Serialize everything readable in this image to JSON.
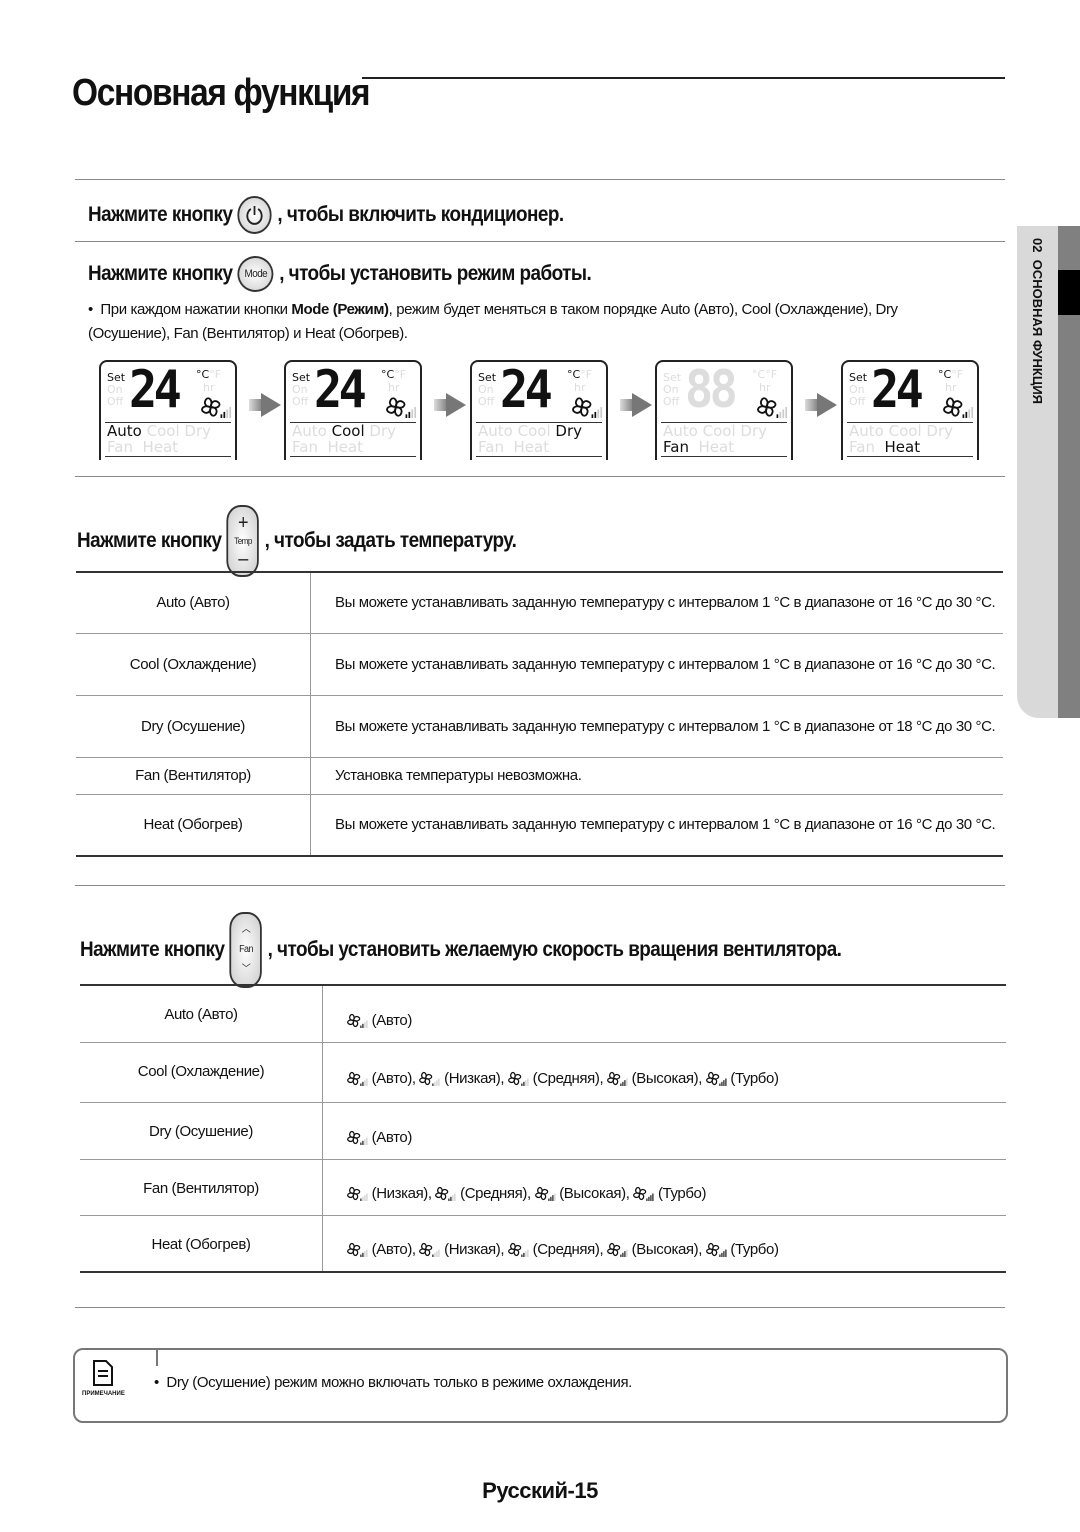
{
  "page_title": "Основная функция",
  "side_tab": {
    "chapter": "02",
    "label": "ОСНОВНАЯ ФУНКЦИЯ"
  },
  "step_power": {
    "prefix": "Нажмите кнопку",
    "suffix": ", чтобы включить кондиционер.",
    "button_icon": "power-icon"
  },
  "step_mode": {
    "prefix": "Нажмите кнопку",
    "button_label": "Mode",
    "suffix": ", чтобы установить режим работы.",
    "bullet_pre": "При каждом нажатии кнопки ",
    "bullet_bold": "Mode (Режим)",
    "bullet_post": ", режим будет меняться в таком порядке Auto (Авто), Cool (Охлаждение), Dry (Осушение), Fan (Вентилятор) и Heat (Обогрев)."
  },
  "lcd": {
    "set": "Set",
    "on": "On",
    "off": "Off",
    "celsius": "°C",
    "fahrenheit": "°F",
    "hr": "hr",
    "row1": [
      "Auto",
      "Cool",
      "Dry"
    ],
    "row2": [
      "Fan",
      "Heat"
    ],
    "panels": [
      {
        "temp": "24",
        "mode": "Auto",
        "fan_level": "auto"
      },
      {
        "temp": "24",
        "mode": "Cool",
        "fan_level": "auto"
      },
      {
        "temp": "24",
        "mode": "Dry",
        "fan_level": "auto"
      },
      {
        "temp": "88",
        "mode": "Fan",
        "fan_level": "low",
        "temp_dim": true
      },
      {
        "temp": "24",
        "mode": "Heat",
        "fan_level": "auto"
      }
    ]
  },
  "step_temp": {
    "prefix": "Нажмите кнопку",
    "button_label": "Temp",
    "suffix": ", чтобы задать температуру.",
    "rows": [
      {
        "mode": "Auto (Авто)",
        "desc": "Вы можете устанавливать заданную температуру с интервалом 1 °C в диапазоне от 16 °C до 30 °C."
      },
      {
        "mode": "Cool (Охлаждение)",
        "desc": "Вы можете устанавливать заданную температуру с интервалом 1 °C в диапазоне от 16 °C до 30 °C."
      },
      {
        "mode": "Dry (Осушение)",
        "desc": "Вы можете устанавливать заданную температуру с интервалом 1 °C в диапазоне от 18 °C до 30 °C."
      },
      {
        "mode": "Fan (Вентилятор)",
        "desc": "Установка температуры невозможна."
      },
      {
        "mode": "Heat (Обогрев)",
        "desc": "Вы можете устанавливать заданную температуру с интервалом 1 °C в диапазоне от 16 °C до 30 °C."
      }
    ]
  },
  "step_fan": {
    "prefix": "Нажмите кнопку",
    "button_label": "Fan",
    "suffix": ", чтобы установить желаемую скорость вращения вентилятора.",
    "rows": [
      {
        "mode": "Auto (Авто)",
        "speeds": [
          {
            "level": "auto",
            "label": "(Авто)"
          }
        ]
      },
      {
        "mode": "Cool (Охлаждение)",
        "speeds": [
          {
            "level": "auto",
            "label": "(Авто),"
          },
          {
            "level": "low",
            "label": "(Низкая),"
          },
          {
            "level": "medium",
            "label": "(Средняя),"
          },
          {
            "level": "high",
            "label": "(Высокая),"
          },
          {
            "level": "turbo",
            "label": "(Турбо)"
          }
        ]
      },
      {
        "mode": "Dry (Осушение)",
        "speeds": [
          {
            "level": "auto",
            "label": "(Авто)"
          }
        ]
      },
      {
        "mode": "Fan (Вентилятор)",
        "speeds": [
          {
            "level": "low",
            "label": "(Низкая),"
          },
          {
            "level": "medium",
            "label": "(Средняя),"
          },
          {
            "level": "high",
            "label": "(Высокая),"
          },
          {
            "level": "turbo",
            "label": "(Турбо)"
          }
        ]
      },
      {
        "mode": "Heat (Обогрев)",
        "speeds": [
          {
            "level": "auto",
            "label": "(Авто),"
          },
          {
            "level": "low",
            "label": "(Низкая),"
          },
          {
            "level": "medium",
            "label": "(Средняя),"
          },
          {
            "level": "high",
            "label": "(Высокая),"
          },
          {
            "level": "turbo",
            "label": "(Турбо)"
          }
        ]
      }
    ]
  },
  "note": {
    "icon_label": "ПРИМЕЧАНИЕ",
    "text": "Dry (Осушение) режим можно включать только в режиме охлаждения."
  },
  "footer": "Русский-15"
}
